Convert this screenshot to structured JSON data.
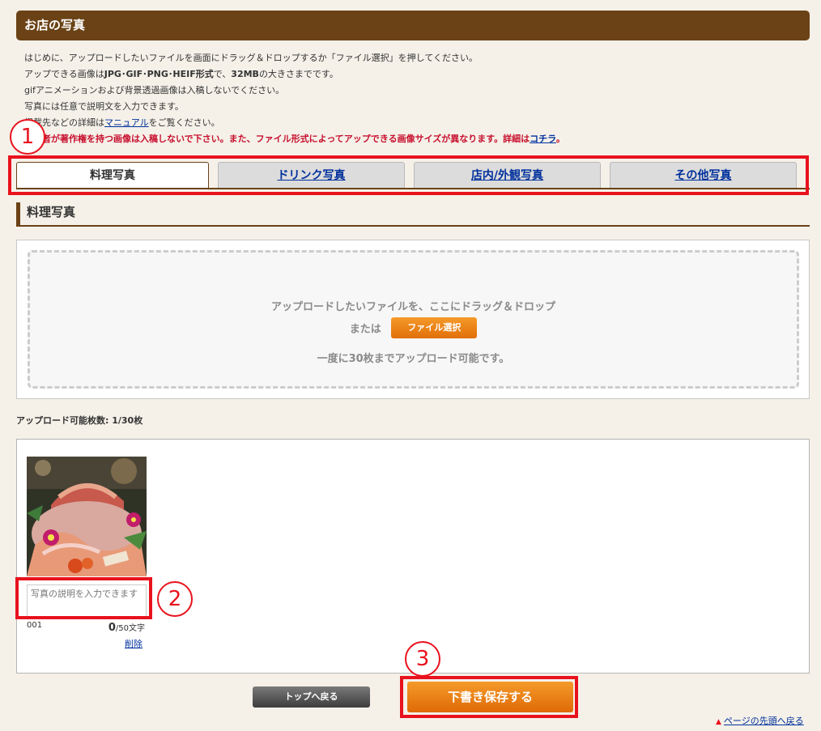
{
  "header": {
    "title": "お店の写真"
  },
  "intro": {
    "line1": "はじめに、アップロードしたいファイルを画面にドラッグ＆ドロップするか「ファイル選択」を押してください。",
    "line2_pre": "アップできる画像は",
    "line2_bold": "JPG･GIF･PNG･HEIF形式",
    "line2_mid": "で、",
    "line2_size": "32MB",
    "line2_post": "の大きさまでです。",
    "line3": "gifアニメーションおよび背景透過画像は入稿しないでください。",
    "line4": "写真には任意で説明文を入力できます。",
    "line5_pre": "掲載先などの詳細は",
    "line5_link": "マニュアル",
    "line5_post": "をご覧ください。",
    "warning": "第三者が著作権を持つ画像は入稿しないで下さい。また、ファイル形式によってアップできる画像サイズが異なります。詳細は",
    "warning_link": "コチラ",
    "warning_end": "。"
  },
  "badges": {
    "one": "1",
    "two": "2",
    "three": "3"
  },
  "tabs": [
    {
      "label": "料理写真",
      "active": true
    },
    {
      "label": "ドリンク写真",
      "active": false
    },
    {
      "label": "店内/外観写真",
      "active": false
    },
    {
      "label": "その他写真",
      "active": false
    }
  ],
  "section": {
    "title": "料理写真"
  },
  "dropzone": {
    "line1": "アップロードしたいファイルを、ここにドラッグ＆ドロップ",
    "or": "または",
    "select_button": "ファイル選択",
    "limit": "一度に30枚までアップロード可能です。"
  },
  "upload_count": "アップロード可能枚数: 1/30枚",
  "photo": {
    "description_placeholder": "写真の説明を入力できます",
    "number": "001",
    "char_count": "0",
    "char_limit": "/50文字",
    "delete": "削除"
  },
  "buttons": {
    "back": "トップへ戻る",
    "save": "下書き保存する"
  },
  "page_top": {
    "marker": "▲",
    "label": "ページの先頭へ戻る"
  },
  "colors": {
    "header_bg": "#6b4215",
    "accent_orange": "#e8830f",
    "annotation_red": "#e8121d",
    "warning_red": "#c8102e",
    "link_blue": "#00309c"
  }
}
